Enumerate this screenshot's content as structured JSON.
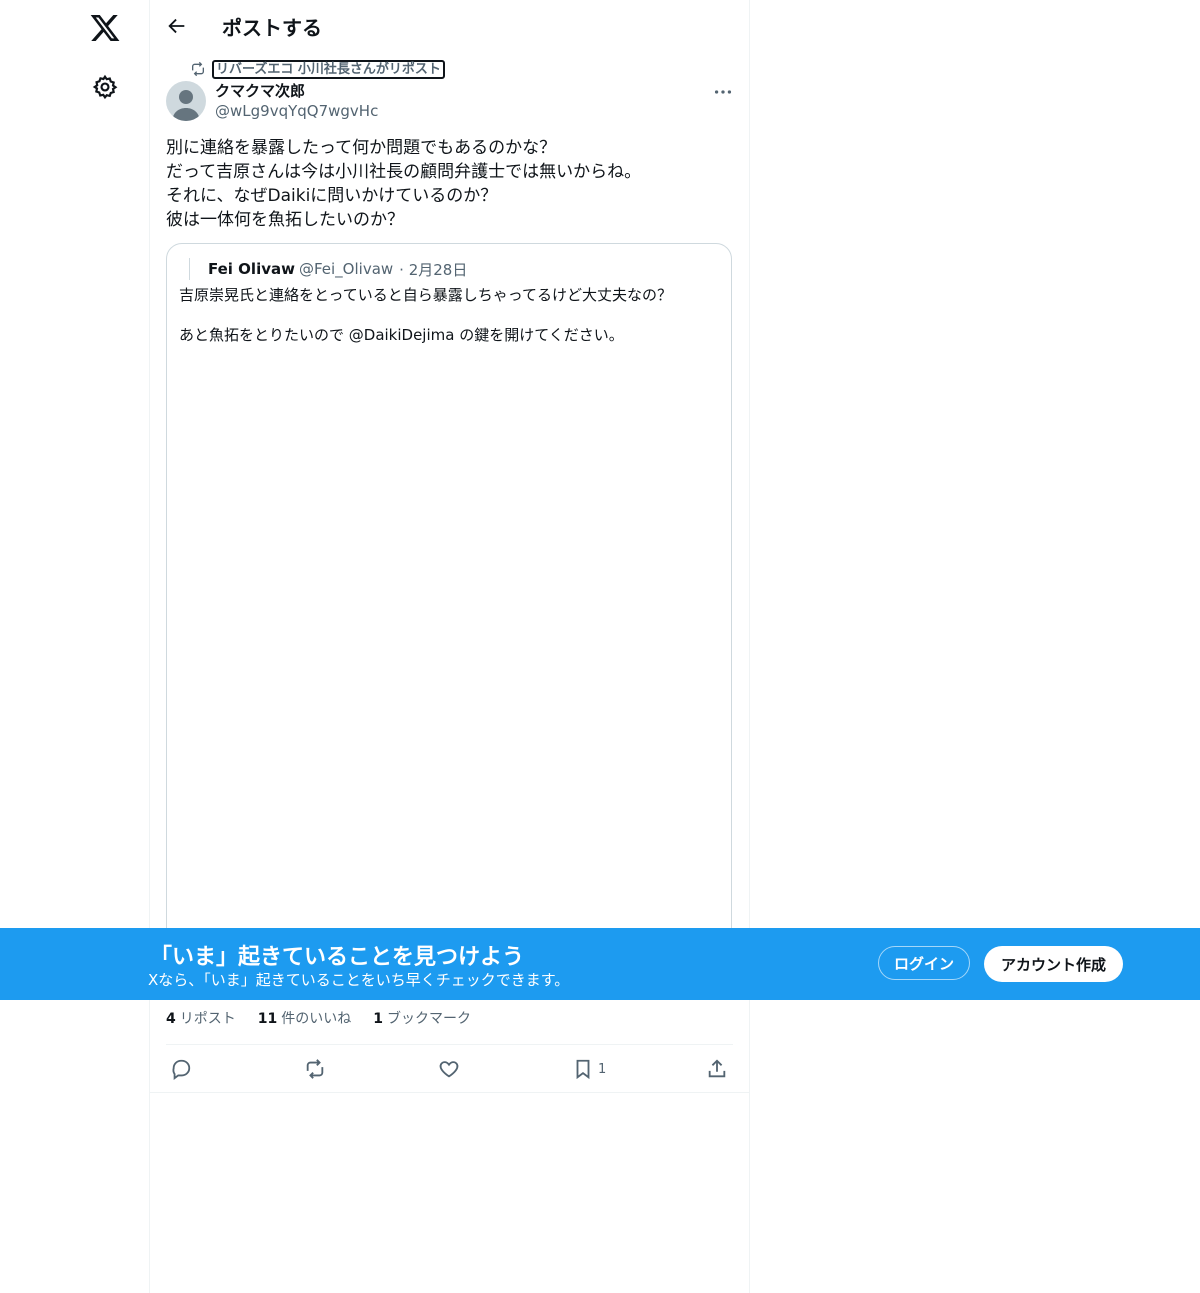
{
  "header": {
    "title": "ポストする"
  },
  "repost_context": {
    "text": "リバーズエコ 小川社長さんがリポスト"
  },
  "post": {
    "author_name": "クマクマ次郎",
    "author_handle": "@wLg9vqYqQ7wgvHc",
    "lines": [
      "別に連絡を暴露したって何か問題でもあるのかな？",
      "だって吉原さんは今は小川社長の顧問弁護士では無いからね。",
      "それに、なぜDaikiに問いかけているのか？",
      "彼は一体何を魚拓したいのか？"
    ]
  },
  "quote": {
    "author_name": "Fei Olivaw",
    "author_handle": "@Fei_Olivaw",
    "date": "· 2月28日",
    "line1": "吉原崇晃氏と連絡をとっていると自ら暴露しちゃってるけど大丈夫なの？",
    "line2": "あと魚拓をとりたいので @DaikiDejima の鍵を開けてください。"
  },
  "stats": {
    "reposts_count": "4",
    "reposts_label": "リポスト",
    "likes_count": "11",
    "likes_label": "件のいいね",
    "bookmarks_count": "1",
    "bookmarks_label": "ブックマーク"
  },
  "actions": {
    "bookmark_count": "1"
  },
  "banner": {
    "title": "「いま」起きていることを見つけよう",
    "subtitle": "Xなら、「いま」起きていることをいち早くチェックできます。",
    "login_label": "ログイン",
    "signup_label": "アカウント作成"
  },
  "colors": {
    "accent": "#1d9bf0",
    "text": "#0f1419",
    "muted": "#536471",
    "border": "#cfd9de"
  },
  "icons": [
    "x-logo-icon",
    "gear-icon",
    "back-arrow-icon",
    "repost-icon",
    "more-icon",
    "reply-icon",
    "like-icon",
    "bookmark-icon",
    "share-icon"
  ]
}
